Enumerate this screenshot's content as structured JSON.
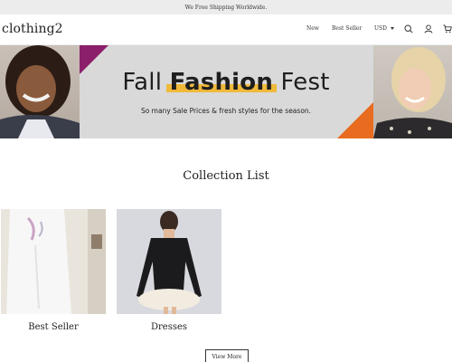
{
  "announcement": "We Free Shipping Worldwide.",
  "header": {
    "logo": "clothing2",
    "nav": [
      "New",
      "Best Seller"
    ],
    "currency": "USD"
  },
  "hero": {
    "title_part1": "Fall ",
    "title_bold": "Fashion",
    "title_part2": " Fest",
    "subtitle": "So many Sale Prices & fresh styles for the season.",
    "colors": {
      "highlight": "#f0b93a",
      "purple": "#8c1f6b",
      "orange": "#e86b1f",
      "background": "#d9d9d9"
    }
  },
  "collection": {
    "title": "Collection List",
    "items": [
      {
        "label": "Best Seller"
      },
      {
        "label": "Dresses"
      }
    ],
    "view_more": "View More"
  }
}
